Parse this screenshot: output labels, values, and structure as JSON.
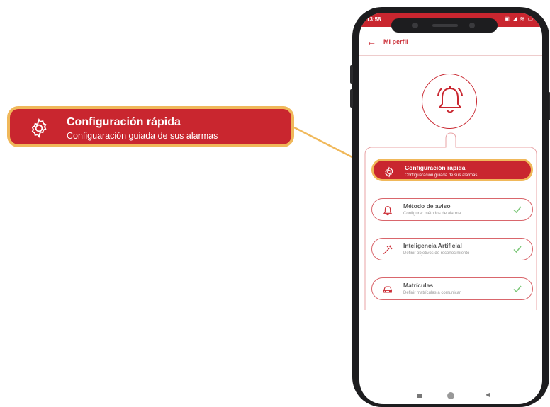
{
  "callout": {
    "title": "Configuración rápida",
    "subtitle": "Configuaración guiada de sus alarmas",
    "icon": "gear-icon"
  },
  "status_bar": {
    "time": "13:58",
    "icons": "▣ ◢ ≋ ▭"
  },
  "app_bar": {
    "title": "Mi perfil",
    "back_icon": "arrow-left-icon"
  },
  "items": [
    {
      "title": "Configuración rápida",
      "subtitle": "Configuaración guiada de sus alarmas",
      "icon": "gear-icon",
      "active": true
    },
    {
      "title": "Método de aviso",
      "subtitle": "Configurar métodos de alarma",
      "icon": "bell-icon",
      "checked": true
    },
    {
      "title": "Inteligencia Artificial",
      "subtitle": "Definir objetivos de reconocimiento",
      "icon": "magic-wand-icon",
      "checked": true
    },
    {
      "title": "Matrículas",
      "subtitle": "Definir matrículas a comunicar",
      "icon": "car-icon",
      "checked": true
    }
  ],
  "colors": {
    "primary": "#c9262f",
    "highlight": "#f0b85a",
    "check": "#7dc87a"
  }
}
